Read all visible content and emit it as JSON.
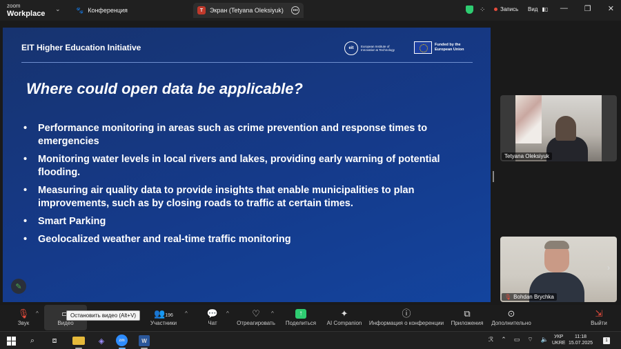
{
  "app": {
    "logo_line1": "zoom",
    "logo_line2": "Workplace",
    "meeting_tab": "Конференция",
    "share_tab": "Экран (Tetyana Oleksiyuk)",
    "share_badge": "T",
    "record_label": "Запись",
    "view_label": "Вид"
  },
  "slide": {
    "org": "EIT Higher Education Initiative",
    "eit_logo_text": "European Institute of Innovation & Technology",
    "eit_logo_mark": "eit",
    "eu_text": "Funded by the European Union",
    "title": "Where could open data be applicable?",
    "bullets": [
      "Performance monitoring in areas such as crime prevention and response times to emergencies",
      "Monitoring water levels in local rivers and lakes, providing early warning of potential flooding.",
      "Measuring air quality data to provide insights that enable municipalities to plan improvements, such as by closing roads to traffic at certain times.",
      "Smart Parking",
      "Geolocalized weather and real-time traffic monitoring"
    ]
  },
  "participants": [
    {
      "name": "Tetyana Oleksiyuk"
    },
    {
      "name": "Bohdan Brychka"
    }
  ],
  "toolbar": {
    "audio": "Звук",
    "video": "Видео",
    "video_tooltip": "Остановить видео (Alt+V)",
    "participants": "Участники",
    "participants_count": "196",
    "chat": "Чат",
    "react": "Отреагировать",
    "share": "Поделиться",
    "ai": "AI Companion",
    "info": "Информация о конференции",
    "apps": "Приложения",
    "more": "Дополнительно",
    "leave": "Выйти"
  },
  "taskbar": {
    "lang_line1": "УКР",
    "lang_line2": "UKRE",
    "time": "11:18",
    "date": "15.07.2025",
    "notif_count": "1"
  }
}
